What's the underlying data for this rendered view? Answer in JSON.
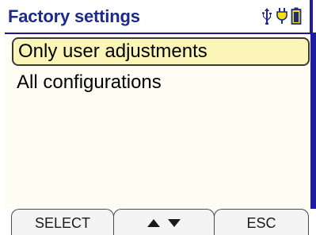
{
  "title": "Factory settings",
  "status_icons": [
    "usb-icon",
    "power-plug-icon",
    "battery-icon"
  ],
  "menu": {
    "items": [
      {
        "label": "Only user adjustments",
        "selected": true
      },
      {
        "label": "All configurations",
        "selected": false
      }
    ]
  },
  "softkeys": {
    "left": "SELECT",
    "middle_icons": [
      "arrow-up-icon",
      "arrow-down-icon"
    ],
    "right": "ESC"
  },
  "colors": {
    "title_text": "#1e2a8a",
    "accent_bar": "#1c1c9c",
    "selection_fill": "#fbf6b8",
    "screen_bg": "#fefdf3",
    "icon_yellow": "#f5e400"
  }
}
